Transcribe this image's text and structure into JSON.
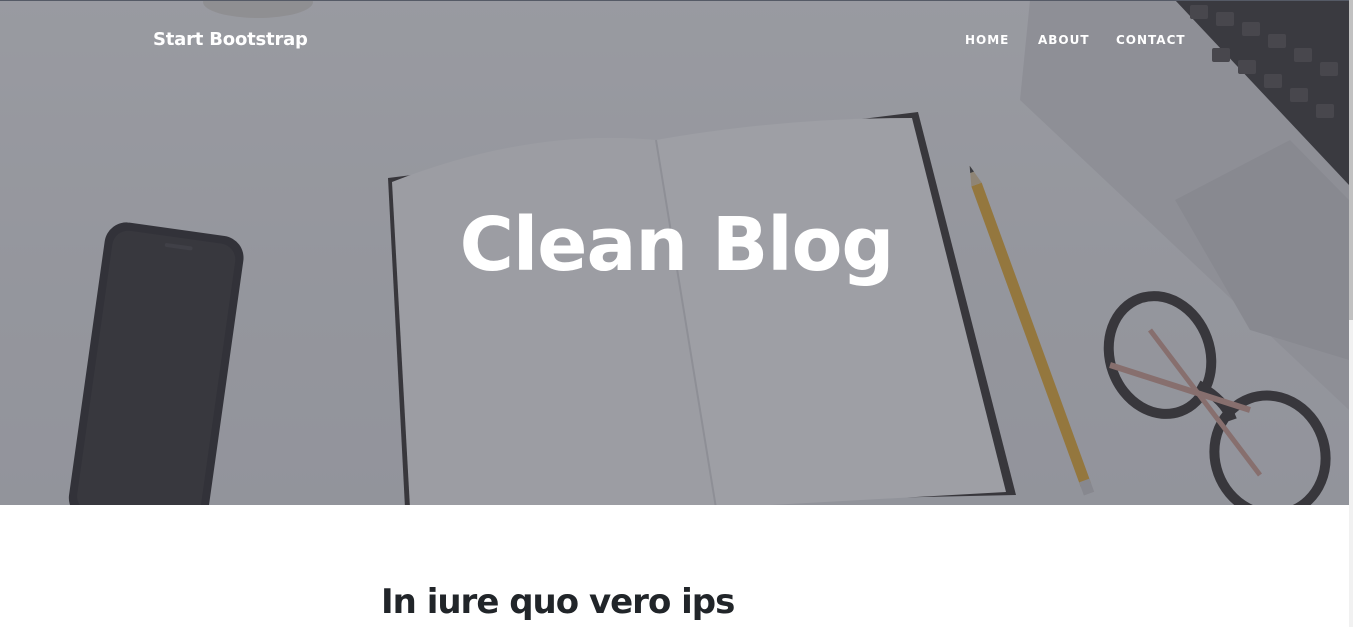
{
  "navbar": {
    "brand": "Start Bootstrap",
    "links": [
      {
        "label": "HOME"
      },
      {
        "label": "ABOUT"
      },
      {
        "label": "CONTACT"
      }
    ]
  },
  "masthead": {
    "title": "Clean Blog",
    "overlay_color": "#464852"
  },
  "main": {
    "post_title": "In iure quo vero ips"
  }
}
